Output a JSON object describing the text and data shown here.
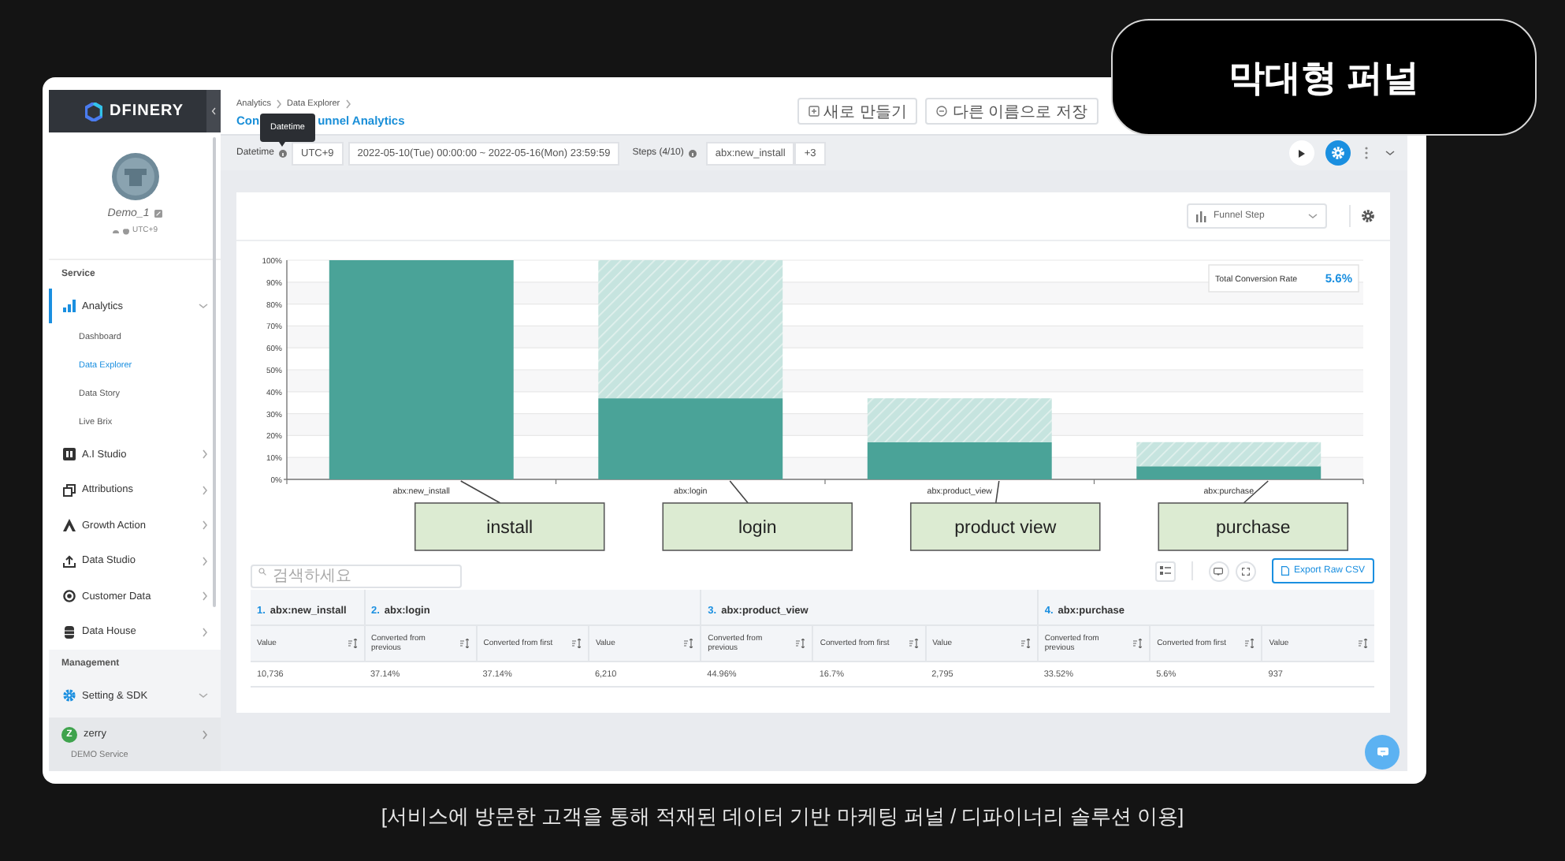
{
  "badge": "막대형 퍼널",
  "caption": "[서비스에 방문한 고객을 통해 적재된 데이터 기반 마케팅 퍼널 / 디파이너리 솔루션 이용]",
  "sidebar": {
    "logo": "DFINERY",
    "profile": {
      "name": "Demo_1",
      "timezone": "UTC+9"
    },
    "sections": [
      {
        "title": "Service",
        "items": [
          {
            "label": "Analytics",
            "kind": "chart",
            "selected": true,
            "expanded": true,
            "children": [
              {
                "label": "Dashboard",
                "selected": false
              },
              {
                "label": "Data Explorer",
                "selected": true
              },
              {
                "label": "Data Story",
                "selected": false
              },
              {
                "label": "Live Brix",
                "selected": false
              }
            ]
          },
          {
            "label": "A.I Studio",
            "kind": "chip",
            "selected": false,
            "expanded": false
          },
          {
            "label": "Attributions",
            "kind": "squares",
            "selected": false,
            "expanded": false
          },
          {
            "label": "Growth Action",
            "kind": "peak",
            "selected": false,
            "expanded": false
          },
          {
            "label": "Data Studio",
            "kind": "upload",
            "selected": false,
            "expanded": false
          },
          {
            "label": "Customer Data",
            "kind": "target",
            "selected": false,
            "expanded": false
          },
          {
            "label": "Data House",
            "kind": "database",
            "selected": false,
            "expanded": false
          }
        ]
      },
      {
        "title": "Management",
        "items": [
          {
            "label": "Setting & SDK",
            "kind": "gear",
            "selected": false,
            "expanded": true
          }
        ]
      }
    ],
    "account": {
      "initial": "Z",
      "name": "zerry",
      "service": "DEMO Service"
    }
  },
  "header": {
    "breadcrumb": [
      "Analytics",
      "Data Explorer"
    ],
    "title_parts": [
      "Con",
      "unnel Analytics"
    ],
    "tooltip": "Datetime",
    "buttons": [
      {
        "kind": "new",
        "label": "새로 만들기"
      },
      {
        "kind": "save",
        "label": "다른 이름으로 저장"
      }
    ]
  },
  "filters": {
    "datetime_label": "Datetime",
    "timezone": "UTC+9",
    "range": "2022-05-10(Tue) 00:00:00 ~ 2022-05-16(Mon) 23:59:59",
    "steps_label": "Steps (4/10)",
    "steps": [
      "abx:new_install",
      "+3"
    ]
  },
  "card": {
    "view_select": "Funnel Step",
    "total_conversion": {
      "label": "Total Conversion Rate",
      "value": "5.6%"
    },
    "chart_data": {
      "type": "bar",
      "stacked": true,
      "grid": true,
      "categories": [
        "abx:new_install",
        "abx:login",
        "abx:product_view",
        "abx:purchase"
      ],
      "series": [
        {
          "color": "#4aa398",
          "values": [
            100,
            37,
            17,
            6
          ]
        },
        {
          "color": "#c6e4df",
          "values": [
            null,
            63,
            20,
            11
          ]
        }
      ],
      "ylim": [
        0,
        100
      ],
      "yticks": [
        {
          "value": 0,
          "label": "0%"
        },
        {
          "value": 10,
          "label": "10%"
        },
        {
          "value": 20,
          "label": "20%"
        },
        {
          "value": 30,
          "label": "30%"
        },
        {
          "value": 40,
          "label": "40%"
        },
        {
          "value": 50,
          "label": "50%"
        },
        {
          "value": 60,
          "label": "60%"
        },
        {
          "value": 70,
          "label": "70%"
        },
        {
          "value": 80,
          "label": "80%"
        },
        {
          "value": 90,
          "label": "90%"
        },
        {
          "value": 100,
          "label": "100%"
        }
      ],
      "annotations": [
        {
          "text": "install"
        },
        {
          "text": "login"
        },
        {
          "text": "product view"
        },
        {
          "text": "purchase"
        }
      ]
    },
    "search": {
      "placeholder": "검색하세요"
    },
    "export_button": "Export Raw CSV",
    "table": {
      "groups": [
        {
          "index": "1.",
          "name": "abx:new_install",
          "columns": [
            "Value"
          ]
        },
        {
          "index": "2.",
          "name": "abx:login",
          "columns": [
            "Converted from previous",
            "Converted from first",
            "Value"
          ]
        },
        {
          "index": "3.",
          "name": "abx:product_view",
          "columns": [
            "Converted from previous",
            "Converted from first",
            "Value"
          ]
        },
        {
          "index": "4.",
          "name": "abx:purchase",
          "columns": [
            "Converted from previous",
            "Converted from first",
            "Value"
          ]
        }
      ],
      "row": [
        "10,736",
        "37.14%",
        "37.14%",
        "6,210",
        "44.96%",
        "16.7%",
        "2,795",
        "33.52%",
        "5.6%",
        "937"
      ]
    }
  }
}
